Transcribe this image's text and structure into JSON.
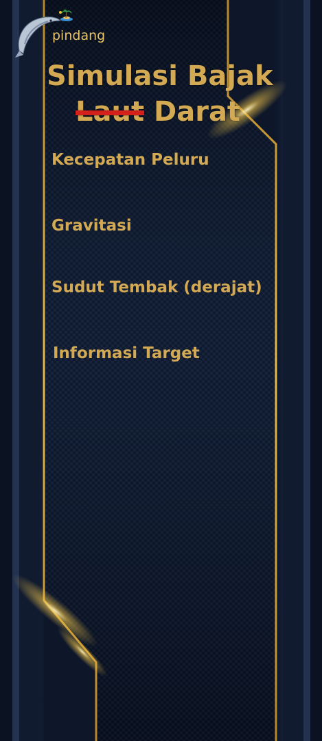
{
  "app": {
    "logo_text": "pindang"
  },
  "title": {
    "line1": "Simulasi Bajak",
    "struck_word": "Laut",
    "line2_rest": "Darat"
  },
  "menu": {
    "items": [
      {
        "label": "Kecepatan Peluru"
      },
      {
        "label": "Gravitasi"
      },
      {
        "label": "Sudut Tembak (derajat)"
      },
      {
        "label": "Informasi Target"
      }
    ]
  },
  "colors": {
    "accent_gold": "#d3a954",
    "strike_red": "#d4201a",
    "background_navy": "#0e172a"
  }
}
